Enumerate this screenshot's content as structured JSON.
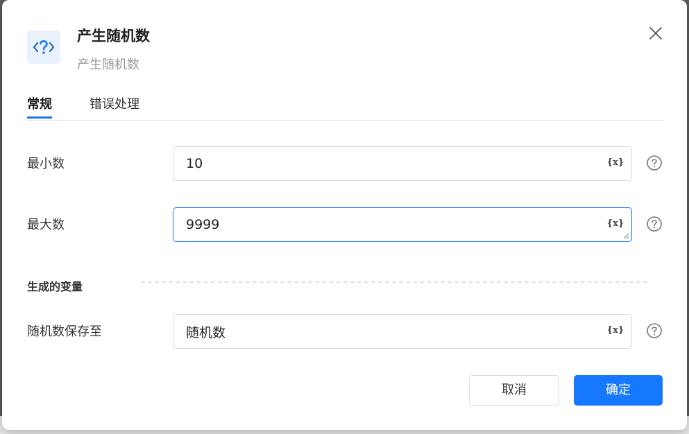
{
  "dialog": {
    "title": "产生随机数",
    "subtitle": "产生随机数",
    "icon": "random-question-icon",
    "close_icon": "close-icon"
  },
  "tabs": [
    {
      "label": "常规",
      "active": true
    },
    {
      "label": "错误处理",
      "active": false
    }
  ],
  "fields": {
    "min": {
      "label": "最小数",
      "value": "10",
      "var_button": "{x}"
    },
    "max": {
      "label": "最大数",
      "value": "9999",
      "var_button": "{x}"
    }
  },
  "output_section": {
    "title": "生成的变量",
    "save_to": {
      "label": "随机数保存至",
      "value": "随机数",
      "var_button": "{x}"
    }
  },
  "buttons": {
    "cancel": "取消",
    "confirm": "确定"
  },
  "colors": {
    "accent": "#1677ff",
    "icon_bg": "#e9f2fc"
  }
}
